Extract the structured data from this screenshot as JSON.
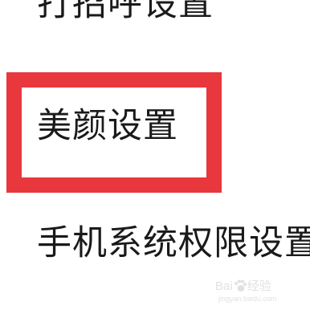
{
  "menu": {
    "items": [
      {
        "label": "打招呼设置"
      },
      {
        "label": "美颜设置"
      },
      {
        "label": "手机系统权限设置"
      }
    ]
  },
  "highlight": {
    "color": "#e8373d",
    "target": "美颜设置"
  },
  "watermark": {
    "brand_prefix": "Bai",
    "brand_suffix": "经验",
    "url": "jingyan.baidu.com",
    "icon": "baidu-paw-icon"
  }
}
